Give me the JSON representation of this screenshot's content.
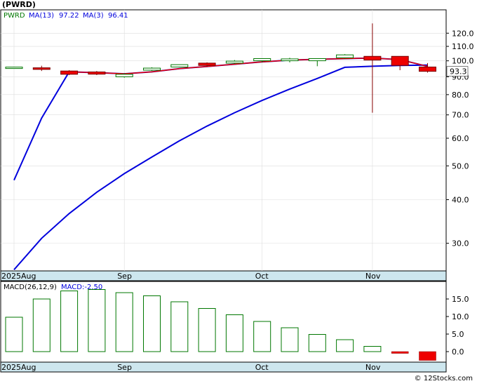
{
  "header": {
    "title": "(PWRD)",
    "credit": "© 12Stocks.com"
  },
  "price_legend": {
    "symbol": "PWRD",
    "ma13_label": "MA(13)",
    "ma13_value": "97.22",
    "ma3_label": "MA(3)",
    "ma3_value": "96.41"
  },
  "macd_legend": {
    "label": "MACD(26,12,9)",
    "value_label": "MACD:-2.50"
  },
  "last_price_label": "93.3",
  "colors": {
    "up_fill": "#ffffff",
    "up_stroke": "#007700",
    "down_fill": "#ee0000",
    "ma_long": "#0000dd",
    "ma_short": "#ee0000",
    "date_band": "#cde6ee",
    "macd_pos_stroke": "#007700",
    "macd_neg_fill": "#ee0000",
    "last_price_box": "#ffffff"
  },
  "chart_data": [
    {
      "type": "candlestick",
      "scale": "log",
      "ylim": [
        25,
        140
      ],
      "ytick_labels": [
        "120.0",
        "110.0",
        "100.0",
        "90.0",
        "80.0",
        "70.0",
        "60.0",
        "50.0",
        "40.0",
        "30.0"
      ],
      "yticks": [
        120,
        110,
        100,
        90,
        80,
        70,
        60,
        50,
        40,
        30
      ],
      "xtick_labels": [
        "2025Aug",
        "Sep",
        "Oct",
        "Nov"
      ],
      "xtick_positions": [
        0,
        4,
        9,
        13
      ],
      "candles": [
        {
          "open": 95.5,
          "high": 95.5,
          "low": 95.5,
          "close": 95.5
        },
        {
          "open": 95.5,
          "high": 96.8,
          "low": 93.5,
          "close": 94.5
        },
        {
          "open": 93.5,
          "high": 94.0,
          "low": 91.0,
          "close": 91.5
        },
        {
          "open": 92.5,
          "high": 93.5,
          "low": 91.0,
          "close": 92.0
        },
        {
          "open": 90.0,
          "high": 92.0,
          "low": 89.5,
          "close": 91.5
        },
        {
          "open": 94.0,
          "high": 95.8,
          "low": 93.5,
          "close": 95.3
        },
        {
          "open": 96.0,
          "high": 97.5,
          "low": 96.0,
          "close": 97.5
        },
        {
          "open": 98.5,
          "high": 99.0,
          "low": 96.0,
          "close": 97.0
        },
        {
          "open": 98.5,
          "high": 100.5,
          "low": 98.0,
          "close": 99.8
        },
        {
          "open": 100.5,
          "high": 101.3,
          "low": 99.0,
          "close": 101.0
        },
        {
          "open": 100.5,
          "high": 102.0,
          "low": 99.0,
          "close": 100.8
        },
        {
          "open": 100.5,
          "high": 101.5,
          "low": 96.5,
          "close": 101.0
        },
        {
          "open": 102.0,
          "high": 104.5,
          "low": 101.5,
          "close": 104.0
        },
        {
          "open": 103.0,
          "high": 128.0,
          "low": 71.0,
          "close": 100.5
        },
        {
          "open": 103.0,
          "high": 103.0,
          "low": 94.0,
          "close": 97.0
        },
        {
          "open": 96.0,
          "high": 98.5,
          "low": 92.5,
          "close": 93.3
        }
      ],
      "ma13": [
        {
          "i": 0,
          "v": 25.2
        },
        {
          "i": 1,
          "v": 31.0
        },
        {
          "i": 2,
          "v": 36.5
        },
        {
          "i": 3,
          "v": 42.0
        },
        {
          "i": 4,
          "v": 47.5
        },
        {
          "i": 5,
          "v": 53.0
        },
        {
          "i": 6,
          "v": 59.0
        },
        {
          "i": 7,
          "v": 65.0
        },
        {
          "i": 8,
          "v": 71.0
        },
        {
          "i": 9,
          "v": 77.0
        },
        {
          "i": 10,
          "v": 83.0
        },
        {
          "i": 11,
          "v": 89.0
        },
        {
          "i": 12,
          "v": 95.8
        },
        {
          "i": 13,
          "v": 96.5
        },
        {
          "i": 14,
          "v": 97.0
        },
        {
          "i": 15,
          "v": 97.22
        }
      ],
      "ma3": [
        {
          "i": 0,
          "v": 45.5
        },
        {
          "i": 1,
          "v": 68.5
        },
        {
          "i": 2,
          "v": 93.0
        },
        {
          "i": 3,
          "v": 92.5
        },
        {
          "i": 4,
          "v": 91.8
        },
        {
          "i": 5,
          "v": 93.0
        },
        {
          "i": 6,
          "v": 95.0
        },
        {
          "i": 7,
          "v": 96.3
        },
        {
          "i": 8,
          "v": 97.8
        },
        {
          "i": 9,
          "v": 99.3
        },
        {
          "i": 10,
          "v": 100.5
        },
        {
          "i": 11,
          "v": 101.0
        },
        {
          "i": 12,
          "v": 101.5
        },
        {
          "i": 13,
          "v": 101.8
        },
        {
          "i": 14,
          "v": 100.8
        },
        {
          "i": 15,
          "v": 96.41
        }
      ]
    },
    {
      "type": "bar",
      "ylim": [
        -3.0,
        20.0
      ],
      "ytick_labels": [
        "15.0",
        "10.0",
        "5.0",
        "0.0"
      ],
      "yticks": [
        15,
        10,
        5,
        0
      ],
      "xtick_labels": [
        "2025Aug",
        "Sep",
        "Oct",
        "Nov"
      ],
      "xtick_positions": [
        0,
        4,
        9,
        13
      ],
      "values": [
        9.8,
        15.0,
        17.3,
        17.7,
        16.8,
        15.9,
        14.2,
        12.3,
        10.5,
        8.6,
        6.8,
        4.9,
        3.4,
        1.5,
        -0.5,
        -2.5
      ]
    }
  ]
}
